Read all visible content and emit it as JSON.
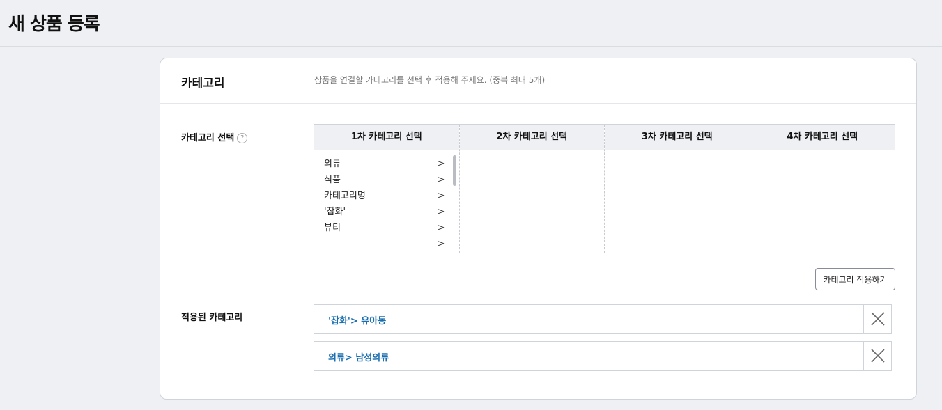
{
  "page": {
    "title": "새 상품 등록"
  },
  "section": {
    "title": "카테고리",
    "description": "상품을 연결할 카테고리를 선택 후 적용해 주세요. (중복 최대 5개)"
  },
  "category_select": {
    "label": "카테고리 선택",
    "help_icon": "?",
    "columns": [
      {
        "header": "1차 카테고리 선택",
        "items": [
          "의류",
          "식품",
          "카테고리명",
          "'잡화'",
          "뷰티",
          ""
        ]
      },
      {
        "header": "2차 카테고리 선택",
        "items": []
      },
      {
        "header": "3차 카테고리 선택",
        "items": []
      },
      {
        "header": "4차 카테고리 선택",
        "items": []
      }
    ],
    "chevron": ">",
    "apply_button": "카테고리 적용하기"
  },
  "applied_categories": {
    "label": "적용된 카테고리",
    "items": [
      "'잡화'> 유아동",
      "의류> 남성의류"
    ]
  },
  "colors": {
    "background": "#eef0f4",
    "link_blue": "#1a6fb0",
    "border": "#cfd3da"
  },
  "icons": {
    "remove": "close-icon",
    "help": "question-circle-icon",
    "chevron": "chevron-right-icon"
  }
}
